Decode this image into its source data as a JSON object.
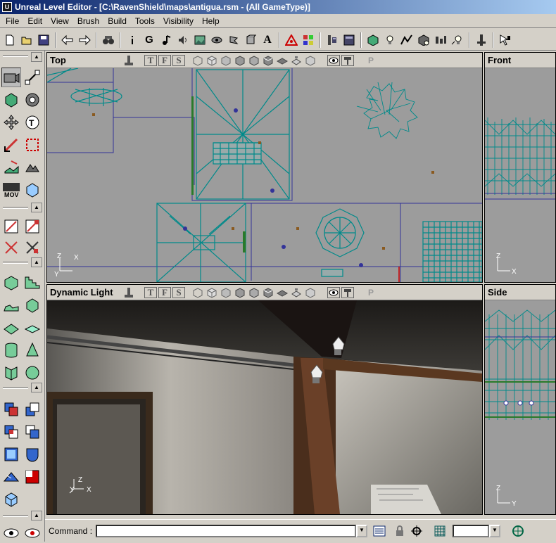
{
  "window": {
    "title": "Unreal Level Editor - [C:\\RavenShield\\maps\\antigua.rsm - (All GameType)]",
    "app_icon_text": "U"
  },
  "menu": [
    "File",
    "Edit",
    "View",
    "Brush",
    "Build",
    "Tools",
    "Visibility",
    "Help"
  ],
  "toolbar_icons": [
    "new-icon",
    "open-icon",
    "save-icon",
    "undo-icon",
    "redo-icon",
    "search-icon",
    "info-icon",
    "G",
    "music-icon",
    "sound-icon",
    "texture-icon",
    "mesh-icon",
    "animation-icon",
    "static-mesh-icon",
    "A",
    "actor-icon",
    "palette-icon",
    "properties-icon",
    "build-geometry-icon",
    "build-lighting-icon",
    "build-paths-icon",
    "build-options-icon",
    "build-all-icon",
    "play-icon",
    "cursor-help-icon"
  ],
  "toolbar_text": {
    "g": "G",
    "a": "A"
  },
  "viewports": {
    "top": {
      "title": "Top",
      "icons": [
        "T",
        "F",
        "S"
      ],
      "axis": {
        "a": "Z",
        "b": "X",
        "c": "Y"
      },
      "p": "P"
    },
    "front": {
      "title": "Front",
      "axis": {
        "a": "Z",
        "b": "X"
      }
    },
    "dynamic": {
      "title": "Dynamic Light",
      "icons": [
        "T",
        "F",
        "S"
      ],
      "axis": {
        "a": "Z",
        "b": "X",
        "c": "Y"
      },
      "p": "P"
    },
    "side": {
      "title": "Side",
      "axis": {
        "a": "Z",
        "b": "Y"
      }
    }
  },
  "left_panel": {
    "mov_label": "MOV"
  },
  "statusbar": {
    "command_label": "Command :",
    "command_value": "",
    "grid_value": ""
  },
  "colors": {
    "wire": "#008a8a",
    "brush": "#333399",
    "selection": "#2a7a2a",
    "title_start": "#0a246a",
    "title_end": "#a6caf0"
  }
}
